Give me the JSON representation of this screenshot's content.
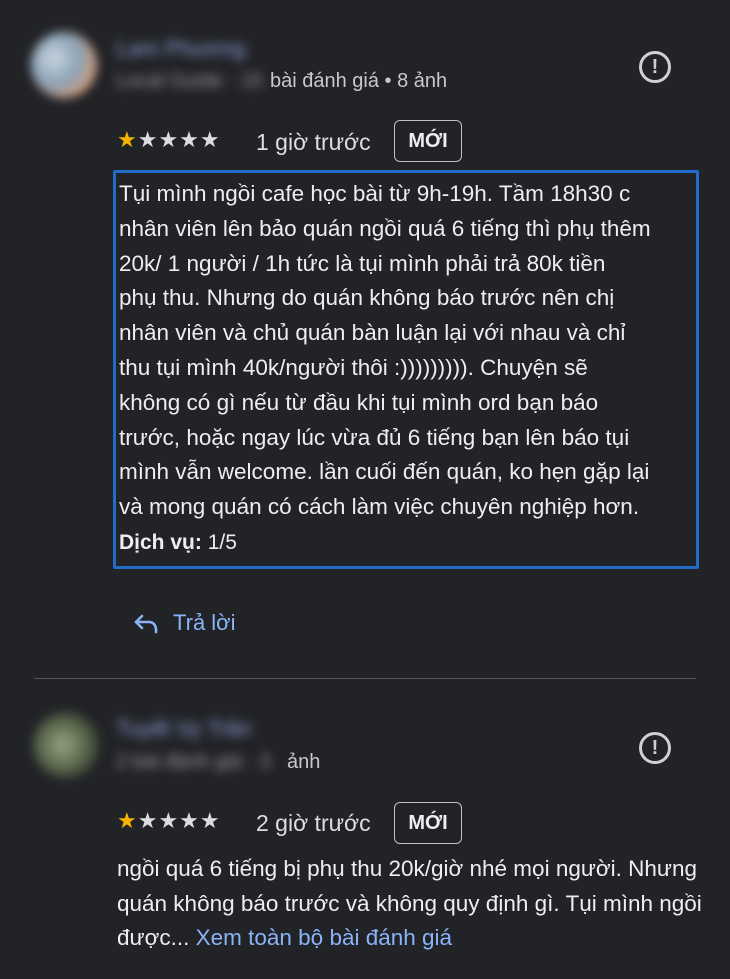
{
  "reviews": [
    {
      "author": "Lam Phương",
      "author_meta_hidden": "Local Guide · 15",
      "author_meta_visible": "bài đánh giá • 8 ảnh",
      "rating": 1,
      "time": "1 giờ trước",
      "badge": "MỚI",
      "text": "Tụi mình ngồi cafe học bài từ 9h-19h. Tầm 18h30 c\nnhân viên lên bảo quán ngồi quá 6 tiếng thì phụ thêm\n20k/ 1 người / 1h tức là tụi mình phải trả 80k tiền\nphụ thu. Nhưng do quán không báo trước nên chị\nnhân viên và chủ quán bàn luận lại với nhau và chỉ\nthu tụi mình 40k/người thôi :))))))))). Chuyện sẽ\nkhông có gì nếu từ đầu khi tụi mình ord bạn báo\ntrước, hoặc ngay lúc vừa đủ 6 tiếng bạn lên báo tụi\nmình vẫn welcome. lần cuối đến quán, ko hẹn gặp lại\nvà mong quán có cách làm việc chuyên nghiệp hơn.",
      "service_label": "Dịch vụ:",
      "service_value": "1/5",
      "reply_label": "Trả lời"
    },
    {
      "author": "Tuyết Vy Trần",
      "author_meta_hidden": "2 bài đánh giá · 3",
      "author_meta_visible": "ảnh",
      "rating": 1,
      "time": "2 giờ trước",
      "badge": "MỚI",
      "text": "ngồi quá 6 tiếng bị phụ thu 20k/giờ nhé mọi người. Nhưng quán không báo trước và không quy định gì. Tụi mình ngồi được...",
      "more_label": "Xem toàn bộ bài đánh giá"
    }
  ],
  "icons": {
    "flag": "report-flag-icon",
    "reply": "reply-arrow-icon",
    "star_filled_color": "#f6b400",
    "link_color": "#8ab4f8",
    "highlight_border_color": "#1f6cc9"
  }
}
